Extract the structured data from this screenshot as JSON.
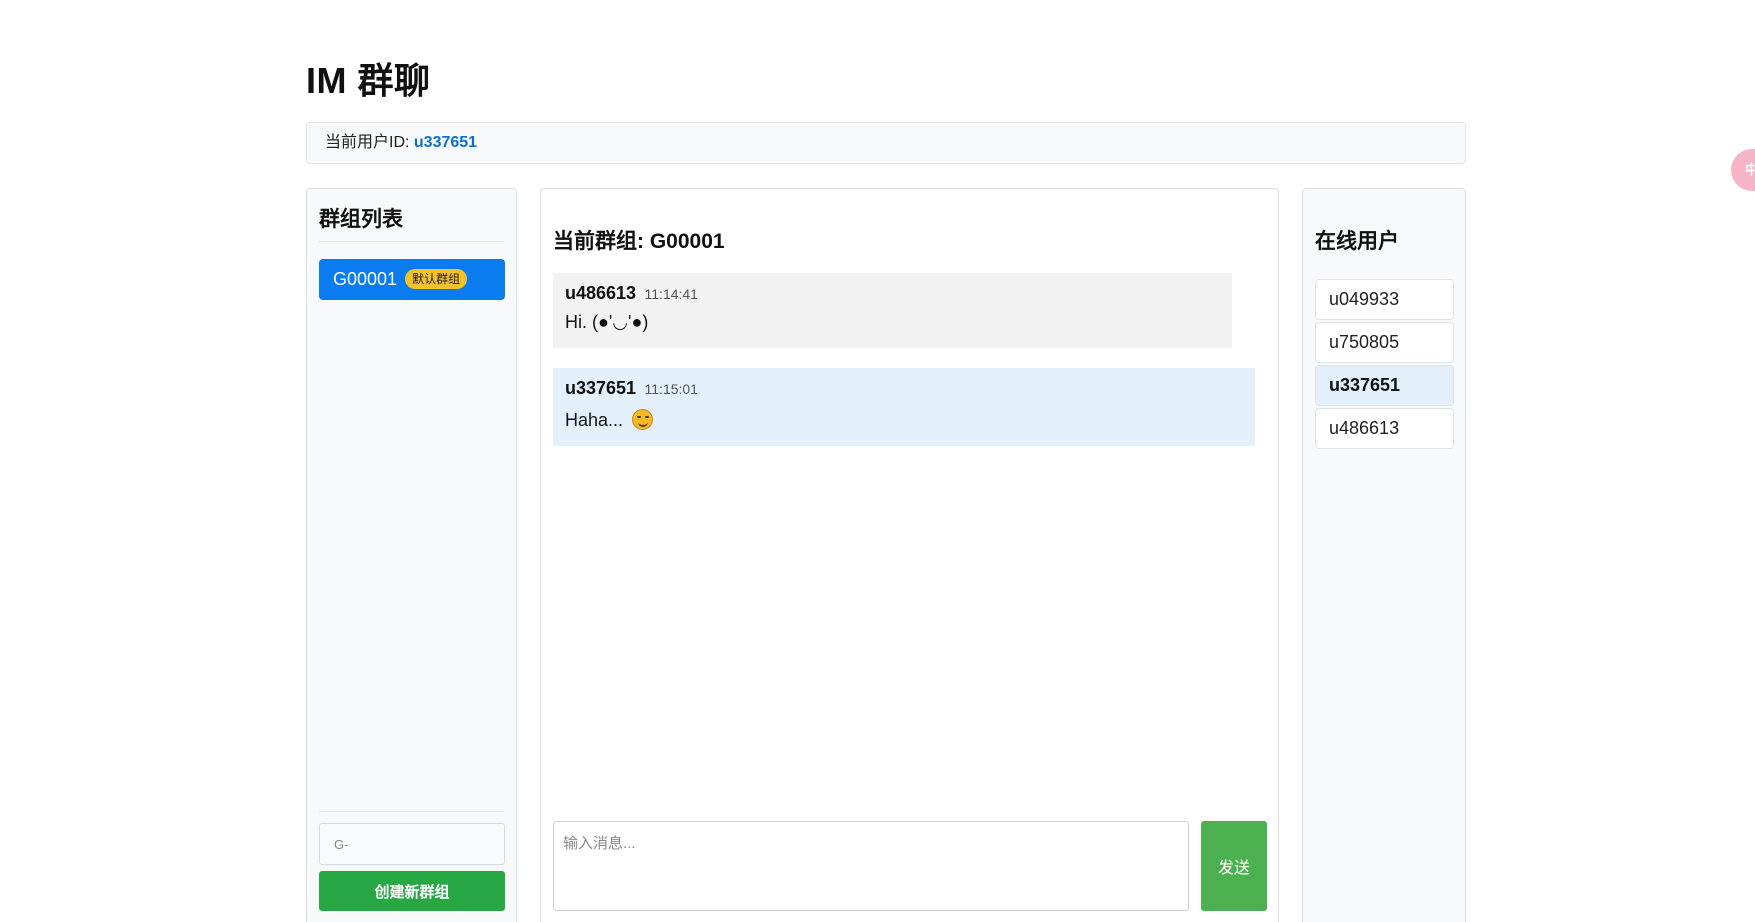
{
  "app": {
    "title": "IM 群聊"
  },
  "user_bar": {
    "label": "当前用户ID: ",
    "user_id": "u337651"
  },
  "groups_panel": {
    "title": "群组列表",
    "groups": [
      {
        "id": "G00001",
        "badge": "默认群组",
        "active": true
      }
    ],
    "group_id_input": {
      "value": "",
      "placeholder": "G-"
    },
    "create_button_label": "创建新群组"
  },
  "chat": {
    "title": "当前群组: G00001",
    "messages": [
      {
        "sender": "u486613",
        "time": "11:14:41",
        "text": "Hi. (●'◡'●)",
        "is_self": false
      },
      {
        "sender": "u337651",
        "time": "11:15:01",
        "text": "Haha... ",
        "emoji": "smiling-face-emoji",
        "is_self": true
      }
    ],
    "input": {
      "value": "",
      "placeholder": "输入消息..."
    },
    "send_label": "发送"
  },
  "online_users": {
    "title": "在线用户",
    "users": [
      {
        "id": "u049933",
        "current": false
      },
      {
        "id": "u750805",
        "current": false
      },
      {
        "id": "u337651",
        "current": true
      },
      {
        "id": "u486613",
        "current": false
      }
    ]
  },
  "float_widget": {
    "label": "中"
  },
  "colors": {
    "primary": "#0a7cf0",
    "user_id": "#0a6fd8",
    "badge": "#f5c12b",
    "create_button": "#28a745",
    "send_button": "#4caf50",
    "self_message_bg": "#e3f0fc",
    "other_message_bg": "#f2f2f2",
    "widget": "#f7b4c8"
  }
}
